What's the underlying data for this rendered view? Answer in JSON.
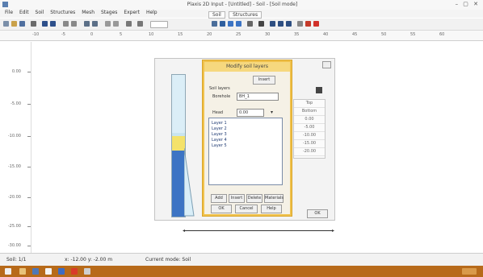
{
  "window": {
    "title": "Plaxis 2D Input - [Untitled] - Soil - [Soil mode]",
    "controls": "– ▢ ✕"
  },
  "menu": [
    "File",
    "Edit",
    "Soil",
    "Structures",
    "Mesh",
    "Stages",
    "Expert",
    "Help"
  ],
  "mode_tabs": [
    "Soil",
    "Structures"
  ],
  "ruler_h": [
    "-10",
    "-5",
    "0",
    "5",
    "10",
    "15",
    "20",
    "25",
    "30",
    "35",
    "40",
    "45",
    "50",
    "55",
    "60"
  ],
  "ruler_v": [
    "0.00",
    "-5.00",
    "-10.00",
    "-15.00",
    "-20.00",
    "-25.00",
    "-30.00"
  ],
  "dialog": {
    "title": "Modify soil layers",
    "top_button": "Insert",
    "section_label": "Soil layers",
    "borehole_label": "Borehole",
    "borehole_value": "BH_1",
    "head_label": "Head",
    "head_value": "0.00",
    "list_items": [
      "Layer 1",
      "Layer 2",
      "Layer 3",
      "Layer 4",
      "Layer 5"
    ],
    "buttons_row1": [
      "Add",
      "Insert",
      "Delete",
      "Materials"
    ],
    "buttons_row2": [
      "OK",
      "Cancel",
      "Help"
    ]
  },
  "side_table": [
    "Top",
    "Bottom",
    "0.00",
    "-5.00",
    "-10.00",
    "-15.00",
    "-20.00"
  ],
  "panel_ok": "OK",
  "status": {
    "left": "Soil: 1/1",
    "coords": "x: -12.00  y: -2.00 m",
    "info": "Current mode: Soil"
  },
  "colors": {
    "accent_dialog": "#f0c14b",
    "layer_light": "#dbeef7",
    "layer_yellow": "#f4e26a",
    "layer_blue": "#3c74c4",
    "taskbar": "#b76a1a"
  }
}
